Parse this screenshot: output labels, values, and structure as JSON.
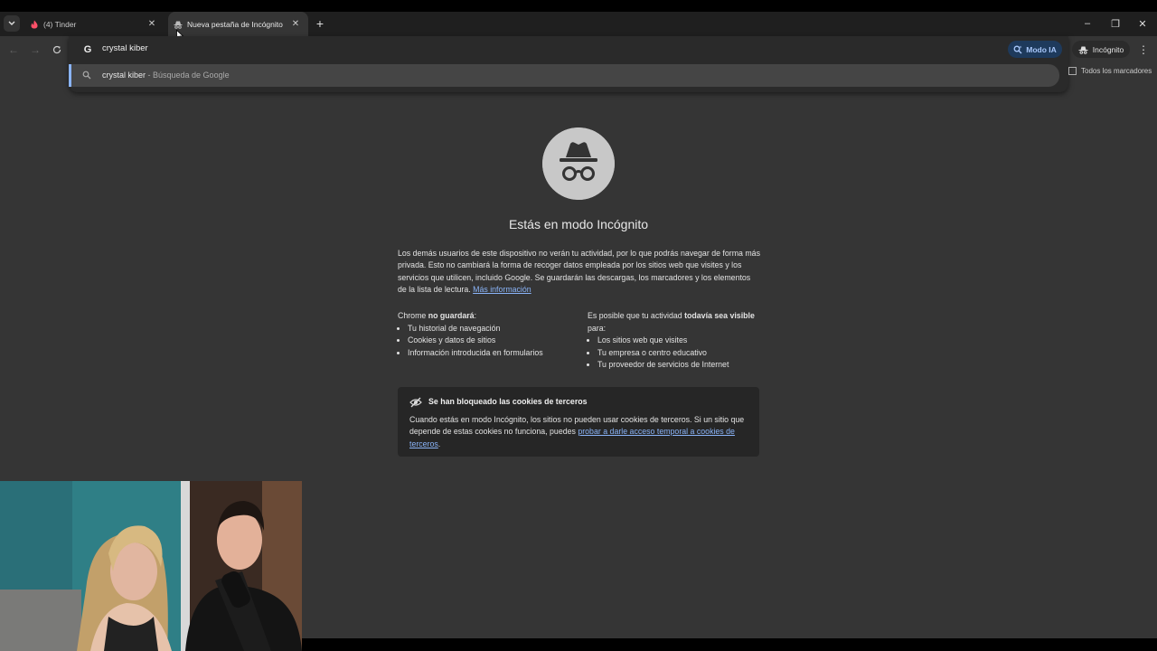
{
  "tabs": [
    {
      "title": "(4) Tinder",
      "active": false
    },
    {
      "title": "Nueva pestaña de Incógnito",
      "active": true
    }
  ],
  "window_controls": {
    "minimize": "–",
    "restore": "❐",
    "close": "✕"
  },
  "toolbar": {
    "omnibox_value": "crystal kiber",
    "modo_ia_label": "Modo IA",
    "incognito_label": "Incógnito"
  },
  "suggestion": {
    "query": "crystal kiber",
    "suffix": " - Búsqueda de Google"
  },
  "bookmarks": {
    "all_label": "Todos los marcadores"
  },
  "page": {
    "title": "Estás en modo Incógnito",
    "intro": "Los demás usuarios de este dispositivo no verán tu actividad, por lo que podrás navegar de forma más privada. Esto no cambiará la forma de recoger datos empleada por los sitios web que visites y los servicios que utilicen, incluido Google. Se guardarán las descargas, los marcadores y los elementos de la lista de lectura.",
    "more_info": "Más información",
    "not_saved": {
      "prefix": "Chrome ",
      "emph": "no guardará",
      "suffix": ":",
      "items": [
        "Tu historial de navegación",
        "Cookies y datos de sitios",
        "Información introducida en formularios"
      ]
    },
    "visible": {
      "prefix": "Es posible que tu actividad ",
      "emph": "todavía sea visible",
      "suffix": " para:",
      "items": [
        "Los sitios web que visites",
        "Tu empresa o centro educativo",
        "Tu proveedor de servicios de Internet"
      ]
    },
    "cookies": {
      "title": "Se han bloqueado las cookies de terceros",
      "text": "Cuando estás en modo Incógnito, los sitios no pueden usar cookies de terceros. Si un sitio que depende de estas cookies no funciona, puedes ",
      "link": "probar a darle acceso temporal a cookies de terceros",
      "end": "."
    }
  }
}
